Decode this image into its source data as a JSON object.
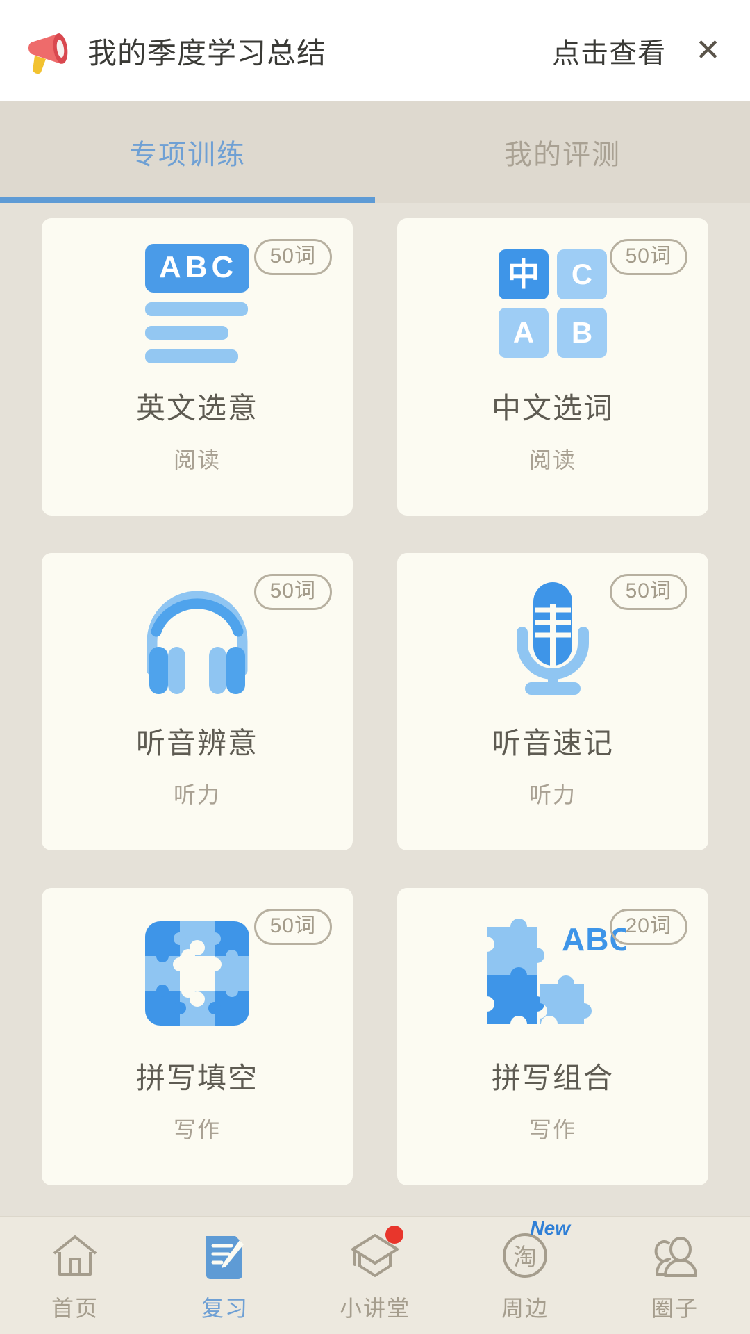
{
  "banner": {
    "icon": "megaphone-icon",
    "title": "我的季度学习总结",
    "action_label": "点击查看",
    "close_label": "✕"
  },
  "tabs": {
    "items": [
      {
        "label": "专项训练",
        "active": true
      },
      {
        "label": "我的评测",
        "active": false
      }
    ],
    "active_color": "#5E9BD5",
    "inactive_color": "#A9A193"
  },
  "cards": [
    {
      "title": "英文选意",
      "category": "阅读",
      "badge": "50词",
      "icon": "abc-lines-icon",
      "icon_text": "ABC"
    },
    {
      "title": "中文选词",
      "category": "阅读",
      "badge": "50词",
      "icon": "word-tiles-icon",
      "tiles": [
        "中",
        "C",
        "A",
        "B"
      ]
    },
    {
      "title": "听音辨意",
      "category": "听力",
      "badge": "50词",
      "icon": "headphones-icon"
    },
    {
      "title": "听音速记",
      "category": "听力",
      "badge": "50词",
      "icon": "microphone-icon"
    },
    {
      "title": "拼写填空",
      "category": "写作",
      "badge": "50词",
      "icon": "puzzle-grid-icon"
    },
    {
      "title": "拼写组合",
      "category": "写作",
      "badge": "20词",
      "icon": "puzzle-pieces-abc-icon",
      "icon_text": "ABC"
    }
  ],
  "tabbar": {
    "items": [
      {
        "label": "首页",
        "icon": "home-icon",
        "active": false,
        "dot": false,
        "new": false
      },
      {
        "label": "复习",
        "icon": "notebook-pen-icon",
        "active": true,
        "dot": false,
        "new": false
      },
      {
        "label": "小讲堂",
        "icon": "graduation-cap-icon",
        "active": false,
        "dot": true,
        "new": false
      },
      {
        "label": "周边",
        "icon": "taobao-circle-icon",
        "active": false,
        "dot": false,
        "new": true,
        "new_label": "New"
      },
      {
        "label": "圈子",
        "icon": "people-icon",
        "active": false,
        "dot": false,
        "new": false
      }
    ]
  },
  "colors": {
    "page_bg": "#E5E1D8",
    "card_bg": "#FCFBF2",
    "accent_blue": "#5E9BD5",
    "icon_blue_dark": "#3E95E8",
    "icon_blue_light": "#9ECDF5",
    "muted_text": "#A9A193",
    "title_text": "#5E5B52",
    "red_dot": "#E8362C"
  }
}
